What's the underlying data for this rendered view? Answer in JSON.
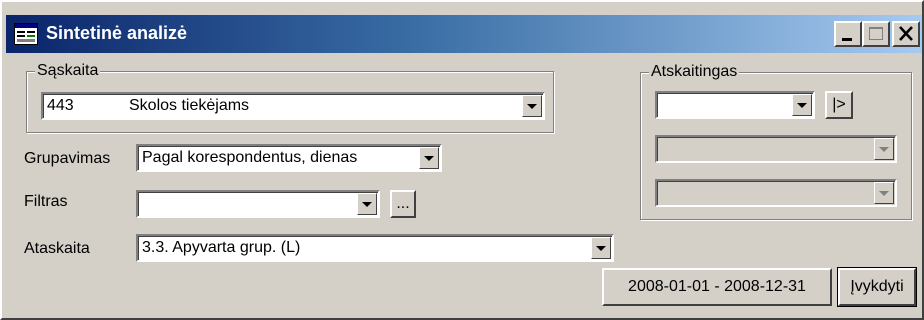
{
  "window": {
    "title": "Sintetinė analizė"
  },
  "caption_buttons": {
    "minimize": "_",
    "maximize": "□",
    "close": "X"
  },
  "saskaita": {
    "legend": "Sąskaita",
    "code": "443",
    "name": "Skolos tiekėjams"
  },
  "grupavimas": {
    "label": "Grupavimas",
    "value": "Pagal korespondentus, dienas"
  },
  "filtras": {
    "label": "Filtras",
    "value": "",
    "browse_label": "..."
  },
  "ataskaita": {
    "label": "Ataskaita",
    "value": "3.3. Apyvarta grup. (L)"
  },
  "atskaitingas": {
    "legend": "Atskaitingas",
    "combo1_value": "",
    "combo2_value": "",
    "combo3_value": "",
    "next_label": "|>"
  },
  "period": {
    "label": "2008-01-01 - 2008-12-31"
  },
  "execute": {
    "label": "Įvykdyti"
  }
}
